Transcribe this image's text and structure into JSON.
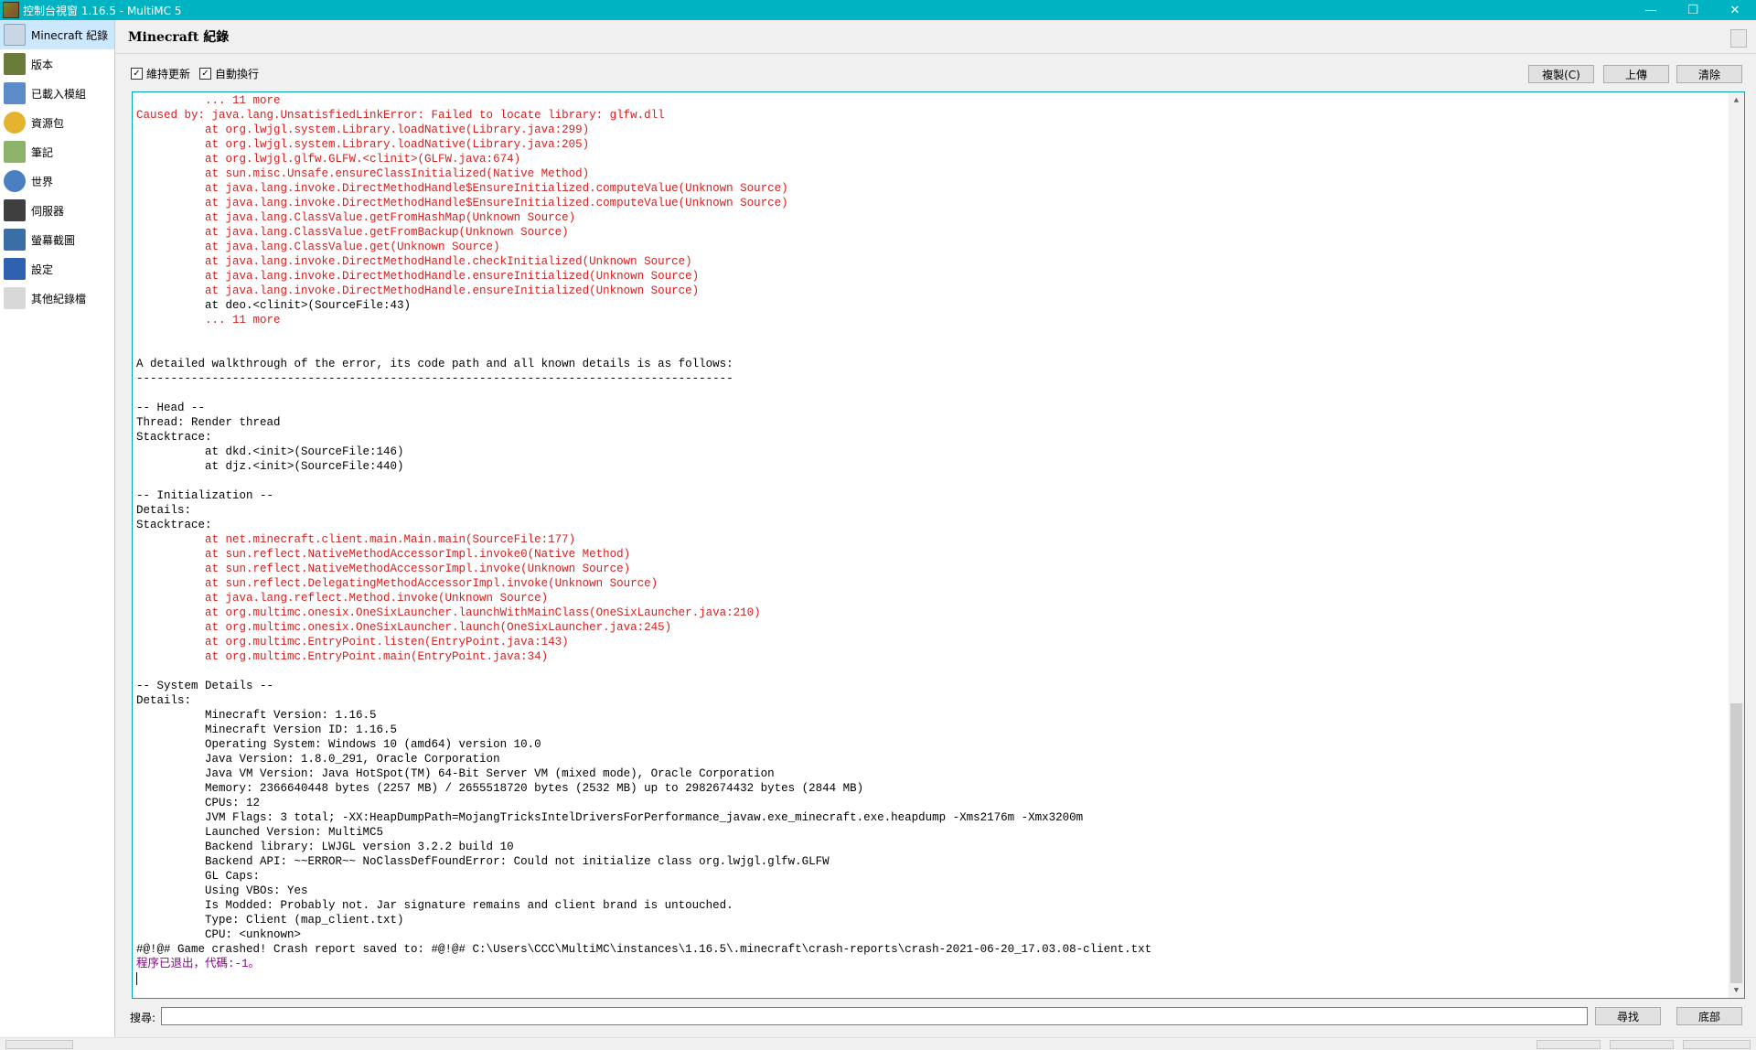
{
  "window": {
    "title": "控制台視窗 1.16.5 - MultiMC 5",
    "controls": {
      "minimize": "—",
      "maximize": "❐",
      "close": "✕"
    }
  },
  "sidebar": {
    "items": [
      {
        "label": "Minecraft 紀錄",
        "icon": "log-icon",
        "selected": true
      },
      {
        "label": "版本",
        "icon": "version-icon"
      },
      {
        "label": "已載入模組",
        "icon": "mods-icon"
      },
      {
        "label": "資源包",
        "icon": "resource-pack-icon"
      },
      {
        "label": "筆記",
        "icon": "notes-icon"
      },
      {
        "label": "世界",
        "icon": "world-icon"
      },
      {
        "label": "伺服器",
        "icon": "server-icon"
      },
      {
        "label": "螢幕截圖",
        "icon": "screenshots-icon"
      },
      {
        "label": "設定",
        "icon": "settings-icon"
      },
      {
        "label": "其他紀錄檔",
        "icon": "other-logs-icon"
      }
    ]
  },
  "header": {
    "title": "Minecraft 紀錄"
  },
  "toolbar": {
    "keep_updating": {
      "label": "維持更新",
      "checked": true
    },
    "auto_wrap": {
      "label": "自動換行",
      "checked": true
    },
    "copy_label": "複製(C)",
    "upload_label": "上傳",
    "clear_label": "清除"
  },
  "search": {
    "label": "搜尋:",
    "value": "",
    "find_label": "尋找",
    "bottom_label": "底部"
  },
  "colors": {
    "titlebar": "#00b3c2",
    "error_text": "#d42020",
    "exit_text": "#8b008b",
    "log_border": "#00a2b8"
  },
  "log": {
    "lines": [
      {
        "text": "          ... 11 more",
        "color": "red"
      },
      {
        "text": "Caused by: java.lang.UnsatisfiedLinkError: Failed to locate library: glfw.dll",
        "color": "red"
      },
      {
        "text": "          at org.lwjgl.system.Library.loadNative(Library.java:299)",
        "color": "red"
      },
      {
        "text": "          at org.lwjgl.system.Library.loadNative(Library.java:205)",
        "color": "red"
      },
      {
        "text": "          at org.lwjgl.glfw.GLFW.<clinit>(GLFW.java:674)",
        "color": "red"
      },
      {
        "text": "          at sun.misc.Unsafe.ensureClassInitialized(Native Method)",
        "color": "red"
      },
      {
        "text": "          at java.lang.invoke.DirectMethodHandle$EnsureInitialized.computeValue(Unknown Source)",
        "color": "red"
      },
      {
        "text": "          at java.lang.invoke.DirectMethodHandle$EnsureInitialized.computeValue(Unknown Source)",
        "color": "red"
      },
      {
        "text": "          at java.lang.ClassValue.getFromHashMap(Unknown Source)",
        "color": "red"
      },
      {
        "text": "          at java.lang.ClassValue.getFromBackup(Unknown Source)",
        "color": "red"
      },
      {
        "text": "          at java.lang.ClassValue.get(Unknown Source)",
        "color": "red"
      },
      {
        "text": "          at java.lang.invoke.DirectMethodHandle.checkInitialized(Unknown Source)",
        "color": "red"
      },
      {
        "text": "          at java.lang.invoke.DirectMethodHandle.ensureInitialized(Unknown Source)",
        "color": "red"
      },
      {
        "text": "          at java.lang.invoke.DirectMethodHandle.ensureInitialized(Unknown Source)",
        "color": "red"
      },
      {
        "text": "          at deo.<clinit>(SourceFile:43)",
        "color": "black"
      },
      {
        "text": "          ... 11 more",
        "color": "red"
      },
      {
        "text": "",
        "color": "black"
      },
      {
        "text": "",
        "color": "black"
      },
      {
        "text": "A detailed walkthrough of the error, its code path and all known details is as follows:",
        "color": "black"
      },
      {
        "text": "---------------------------------------------------------------------------------------",
        "color": "black"
      },
      {
        "text": "",
        "color": "black"
      },
      {
        "text": "-- Head --",
        "color": "black"
      },
      {
        "text": "Thread: Render thread",
        "color": "black"
      },
      {
        "text": "Stacktrace:",
        "color": "black"
      },
      {
        "text": "          at dkd.<init>(SourceFile:146)",
        "color": "black"
      },
      {
        "text": "          at djz.<init>(SourceFile:440)",
        "color": "black"
      },
      {
        "text": "",
        "color": "black"
      },
      {
        "text": "-- Initialization --",
        "color": "black"
      },
      {
        "text": "Details:",
        "color": "black"
      },
      {
        "text": "Stacktrace:",
        "color": "black"
      },
      {
        "text": "          at net.minecraft.client.main.Main.main(SourceFile:177)",
        "color": "red"
      },
      {
        "text": "          at sun.reflect.NativeMethodAccessorImpl.invoke0(Native Method)",
        "color": "red"
      },
      {
        "text": "          at sun.reflect.NativeMethodAccessorImpl.invoke(Unknown Source)",
        "color": "red"
      },
      {
        "text": "          at sun.reflect.DelegatingMethodAccessorImpl.invoke(Unknown Source)",
        "color": "red"
      },
      {
        "text": "          at java.lang.reflect.Method.invoke(Unknown Source)",
        "color": "red"
      },
      {
        "text": "          at org.multimc.onesix.OneSixLauncher.launchWithMainClass(OneSixLauncher.java:210)",
        "color": "red"
      },
      {
        "text": "          at org.multimc.onesix.OneSixLauncher.launch(OneSixLauncher.java:245)",
        "color": "red"
      },
      {
        "text": "          at org.multimc.EntryPoint.listen(EntryPoint.java:143)",
        "color": "red"
      },
      {
        "text": "          at org.multimc.EntryPoint.main(EntryPoint.java:34)",
        "color": "red"
      },
      {
        "text": "",
        "color": "black"
      },
      {
        "text": "-- System Details --",
        "color": "black"
      },
      {
        "text": "Details:",
        "color": "black"
      },
      {
        "text": "          Minecraft Version: 1.16.5",
        "color": "black"
      },
      {
        "text": "          Minecraft Version ID: 1.16.5",
        "color": "black"
      },
      {
        "text": "          Operating System: Windows 10 (amd64) version 10.0",
        "color": "black"
      },
      {
        "text": "          Java Version: 1.8.0_291, Oracle Corporation",
        "color": "black"
      },
      {
        "text": "          Java VM Version: Java HotSpot(TM) 64-Bit Server VM (mixed mode), Oracle Corporation",
        "color": "black"
      },
      {
        "text": "          Memory: 2366640448 bytes (2257 MB) / 2655518720 bytes (2532 MB) up to 2982674432 bytes (2844 MB)",
        "color": "black"
      },
      {
        "text": "          CPUs: 12",
        "color": "black"
      },
      {
        "text": "          JVM Flags: 3 total; -XX:HeapDumpPath=MojangTricksIntelDriversForPerformance_javaw.exe_minecraft.exe.heapdump -Xms2176m -Xmx3200m",
        "color": "black"
      },
      {
        "text": "          Launched Version: MultiMC5",
        "color": "black"
      },
      {
        "text": "          Backend library: LWJGL version 3.2.2 build 10",
        "color": "black"
      },
      {
        "text": "          Backend API: ~~ERROR~~ NoClassDefFoundError: Could not initialize class org.lwjgl.glfw.GLFW",
        "color": "black"
      },
      {
        "text": "          GL Caps:",
        "color": "black"
      },
      {
        "text": "          Using VBOs: Yes",
        "color": "black"
      },
      {
        "text": "          Is Modded: Probably not. Jar signature remains and client brand is untouched.",
        "color": "black"
      },
      {
        "text": "          Type: Client (map_client.txt)",
        "color": "black"
      },
      {
        "text": "          CPU: <unknown>",
        "color": "black"
      },
      {
        "text": "#@!@# Game crashed! Crash report saved to: #@!@# C:\\Users\\CCC\\MultiMC\\instances\\1.16.5\\.minecraft\\crash-reports\\crash-2021-06-20_17.03.08-client.txt",
        "color": "black"
      },
      {
        "text": "程序已退出，代碼:-1。",
        "color": "purple"
      }
    ]
  }
}
